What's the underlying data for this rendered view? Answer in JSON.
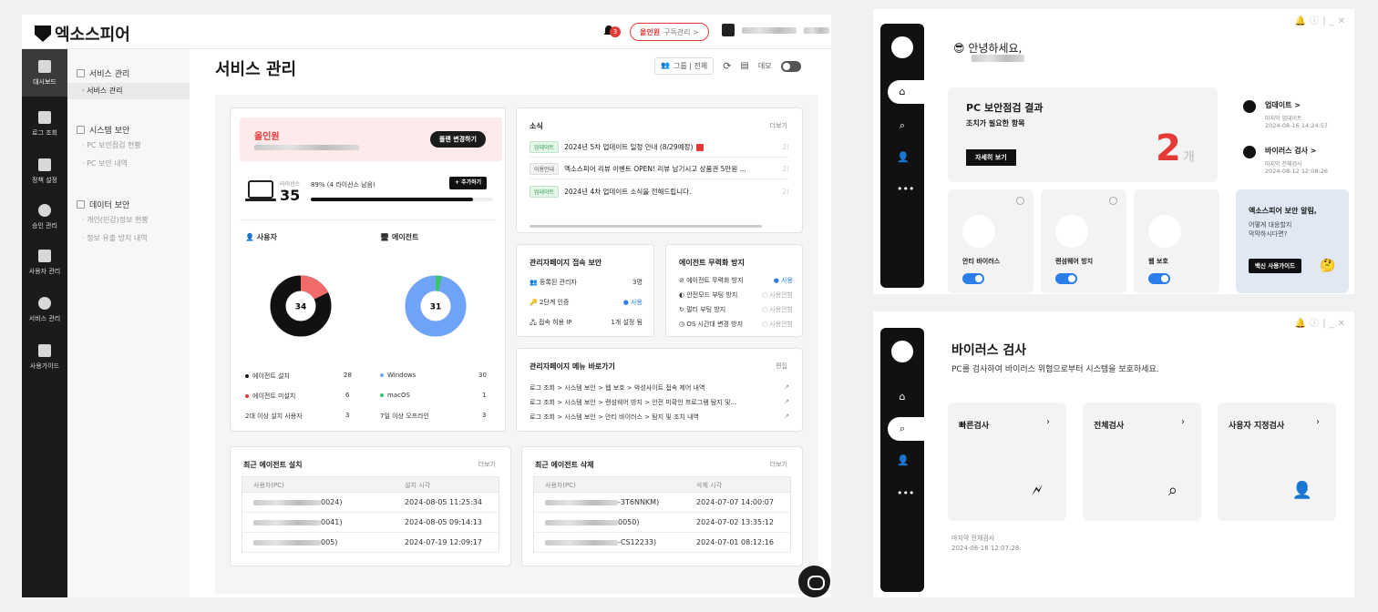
{
  "console": {
    "brand": "엑소스피어",
    "notifications_count": "3",
    "plan_pill": {
      "name": "올인원",
      "action": "구독관리 >"
    },
    "rail": [
      {
        "label": "대시보드",
        "icon": "bar-chart-icon"
      },
      {
        "label": "로그 조회",
        "icon": "log-icon"
      },
      {
        "label": "정책 설정",
        "icon": "clipboard-icon"
      },
      {
        "label": "승인 관리",
        "icon": "check-circle-icon"
      },
      {
        "label": "사용자 관리",
        "icon": "user-add-icon"
      },
      {
        "label": "서비스 관리",
        "icon": "gear-icon"
      },
      {
        "label": "사용가이드",
        "icon": "book-icon"
      }
    ],
    "submenu": [
      {
        "group": "서비스 관리",
        "items": [
          "· 서비스 관리"
        ]
      },
      {
        "group": "시스템 보안",
        "items": [
          "· PC 보안점검 현황",
          "· PC 보안 내역"
        ]
      },
      {
        "group": "데이터 보안",
        "items": [
          "· 개인(민감)정보 현황",
          "· 정보 유출 방지 내역"
        ]
      }
    ],
    "page_title": "서비스 관리",
    "toolbar": {
      "group_btn": "그룹 | 전체",
      "demo_label": "데모"
    },
    "plan_card": {
      "plan_name": "올인원",
      "change_button": "플랜 변경하기",
      "license_label": "라이선스",
      "license_count": "35",
      "usage_text": "89% (4 라이선스 남음)",
      "usage_fraction": 0.89,
      "add_button": "+ 추가하기"
    },
    "users": {
      "title": "사용자",
      "donut_center": "34",
      "rows": [
        {
          "label": "에이전트 설치",
          "value": "28",
          "color": "#111111"
        },
        {
          "label": "에이전트 미설치",
          "value": "6",
          "color": "#e53935"
        },
        {
          "label": "2대 이상 설치 사용자",
          "value": "3",
          "color": ""
        }
      ]
    },
    "agents": {
      "title": "에이전트",
      "donut_center": "31",
      "rows": [
        {
          "label": "Windows",
          "value": "30",
          "color": "#6fa3f7"
        },
        {
          "label": "macOS",
          "value": "1",
          "color": "#3cc46b"
        },
        {
          "label": "7일 이상 오프라인",
          "value": "3",
          "color": ""
        }
      ]
    },
    "news": {
      "title": "소식",
      "more": "더보기",
      "items": [
        {
          "tag": "업데이트",
          "text": "2024년 5차 업데이트 일정 안내 (8/29예정)",
          "date": "2("
        },
        {
          "tag": "이용안내",
          "text": "엑소스피어 리뷰 이벤트 OPEN! 리뷰 남기시고 상품권 5만원 ...",
          "date": "2("
        },
        {
          "tag": "업데이트",
          "text": "2024년 4차 업데이트 소식을 전해드립니다.",
          "date": "2("
        }
      ]
    },
    "admin_security": {
      "title": "관리자페이지 접속 보안",
      "rows": [
        {
          "label": "등록된 관리자",
          "value": "3명"
        },
        {
          "label": "2단계 인증",
          "value": "● 사용"
        },
        {
          "label": "접속 허용 IP",
          "value": "1개 설정 됨"
        }
      ]
    },
    "agent_disable": {
      "title": "에이전트 무력화 방지",
      "rows": [
        {
          "label": "에이전트 무력화 방지",
          "value": "● 사용"
        },
        {
          "label": "안전모드 부팅 방지",
          "value": "○ 사용안함"
        },
        {
          "label": "멀티 부팅 방지",
          "value": "○ 사용안함"
        },
        {
          "label": "OS 시간대 변경 방지",
          "value": "○ 사용안함"
        }
      ]
    },
    "shortcuts": {
      "title": "관리자페이지 메뉴 바로가기",
      "edit": "편집",
      "items": [
        "로그 조회 > 시스템 보안 > 웹 보호 > 악성사이트 접속 제어 내역",
        "로그 조회 > 시스템 보안 > 랜섬웨어 방지 > 안전 미확인 프로그램 탐지 및...",
        "로그 조회 > 시스템 보안 > 안티 바이러스 > 탐지 및 조치 내역"
      ]
    },
    "recent_install": {
      "title": "최근 에이전트 설치",
      "more": "더보기",
      "headers": [
        "사용자(PC)",
        "설치 시각"
      ],
      "rows": [
        {
          "user": "0024)",
          "time": "2024-08-05 11:25:34"
        },
        {
          "user": "0041)",
          "time": "2024-08-05 09:14:13"
        },
        {
          "user": "005)",
          "time": "2024-07-19 12:09:17"
        }
      ]
    },
    "recent_delete": {
      "title": "최근 에이전트 삭제",
      "more": "더보기",
      "headers": [
        "사용자(PC)",
        "삭제 시각"
      ],
      "rows": [
        {
          "user": "-3T6NNKM)",
          "time": "2024-07-07 14:00:07"
        },
        {
          "user": "0050)",
          "time": "2024-07-02 13:35:12"
        },
        {
          "user": "-CS12233)",
          "time": "2024-07-01 08:12:16"
        }
      ]
    }
  },
  "agent_home": {
    "greeting": "😎 안녕하세요,",
    "hero": {
      "title": "PC 보안점검 결과",
      "subtitle": "조치가 필요한 항목",
      "button": "자세히 보기",
      "count": "2",
      "unit": "개"
    },
    "update": {
      "title": "업데이트 >",
      "line1": "마지막 업데이트",
      "line2": "2024-08-16 14:24:57"
    },
    "virus": {
      "title": "바이러스 검사 >",
      "line1": "마지막 전체검사",
      "line2": "2024-08-12 12:08:26"
    },
    "features": [
      {
        "name": "안티 바이러스",
        "icon": "syringe-icon",
        "enabled": true
      },
      {
        "name": "랜섬웨어 방지",
        "icon": "money-bag-icon",
        "enabled": true
      },
      {
        "name": "웹 보호",
        "icon": "browser-shield-icon",
        "enabled": true
      }
    ],
    "notice": {
      "title": "엑소스피어 보안 알림,",
      "text1": "어떻게 대응할지",
      "text2": "막막하시다면?",
      "button": "백신 사용가이드"
    }
  },
  "agent_scan": {
    "title": "바이러스 검사",
    "subtitle": "PC를 검사하여 바이러스 위협으로부터 시스템을 보호하세요.",
    "cards": [
      {
        "name": "빠른검사",
        "icon": "lightning-file-icon"
      },
      {
        "name": "전체검사",
        "icon": "search-check-icon"
      },
      {
        "name": "사용자 지정검사",
        "icon": "user-check-icon"
      }
    ],
    "last_label": "마지막 전체검사",
    "last_time": "2024-08-16 12:07:28"
  }
}
